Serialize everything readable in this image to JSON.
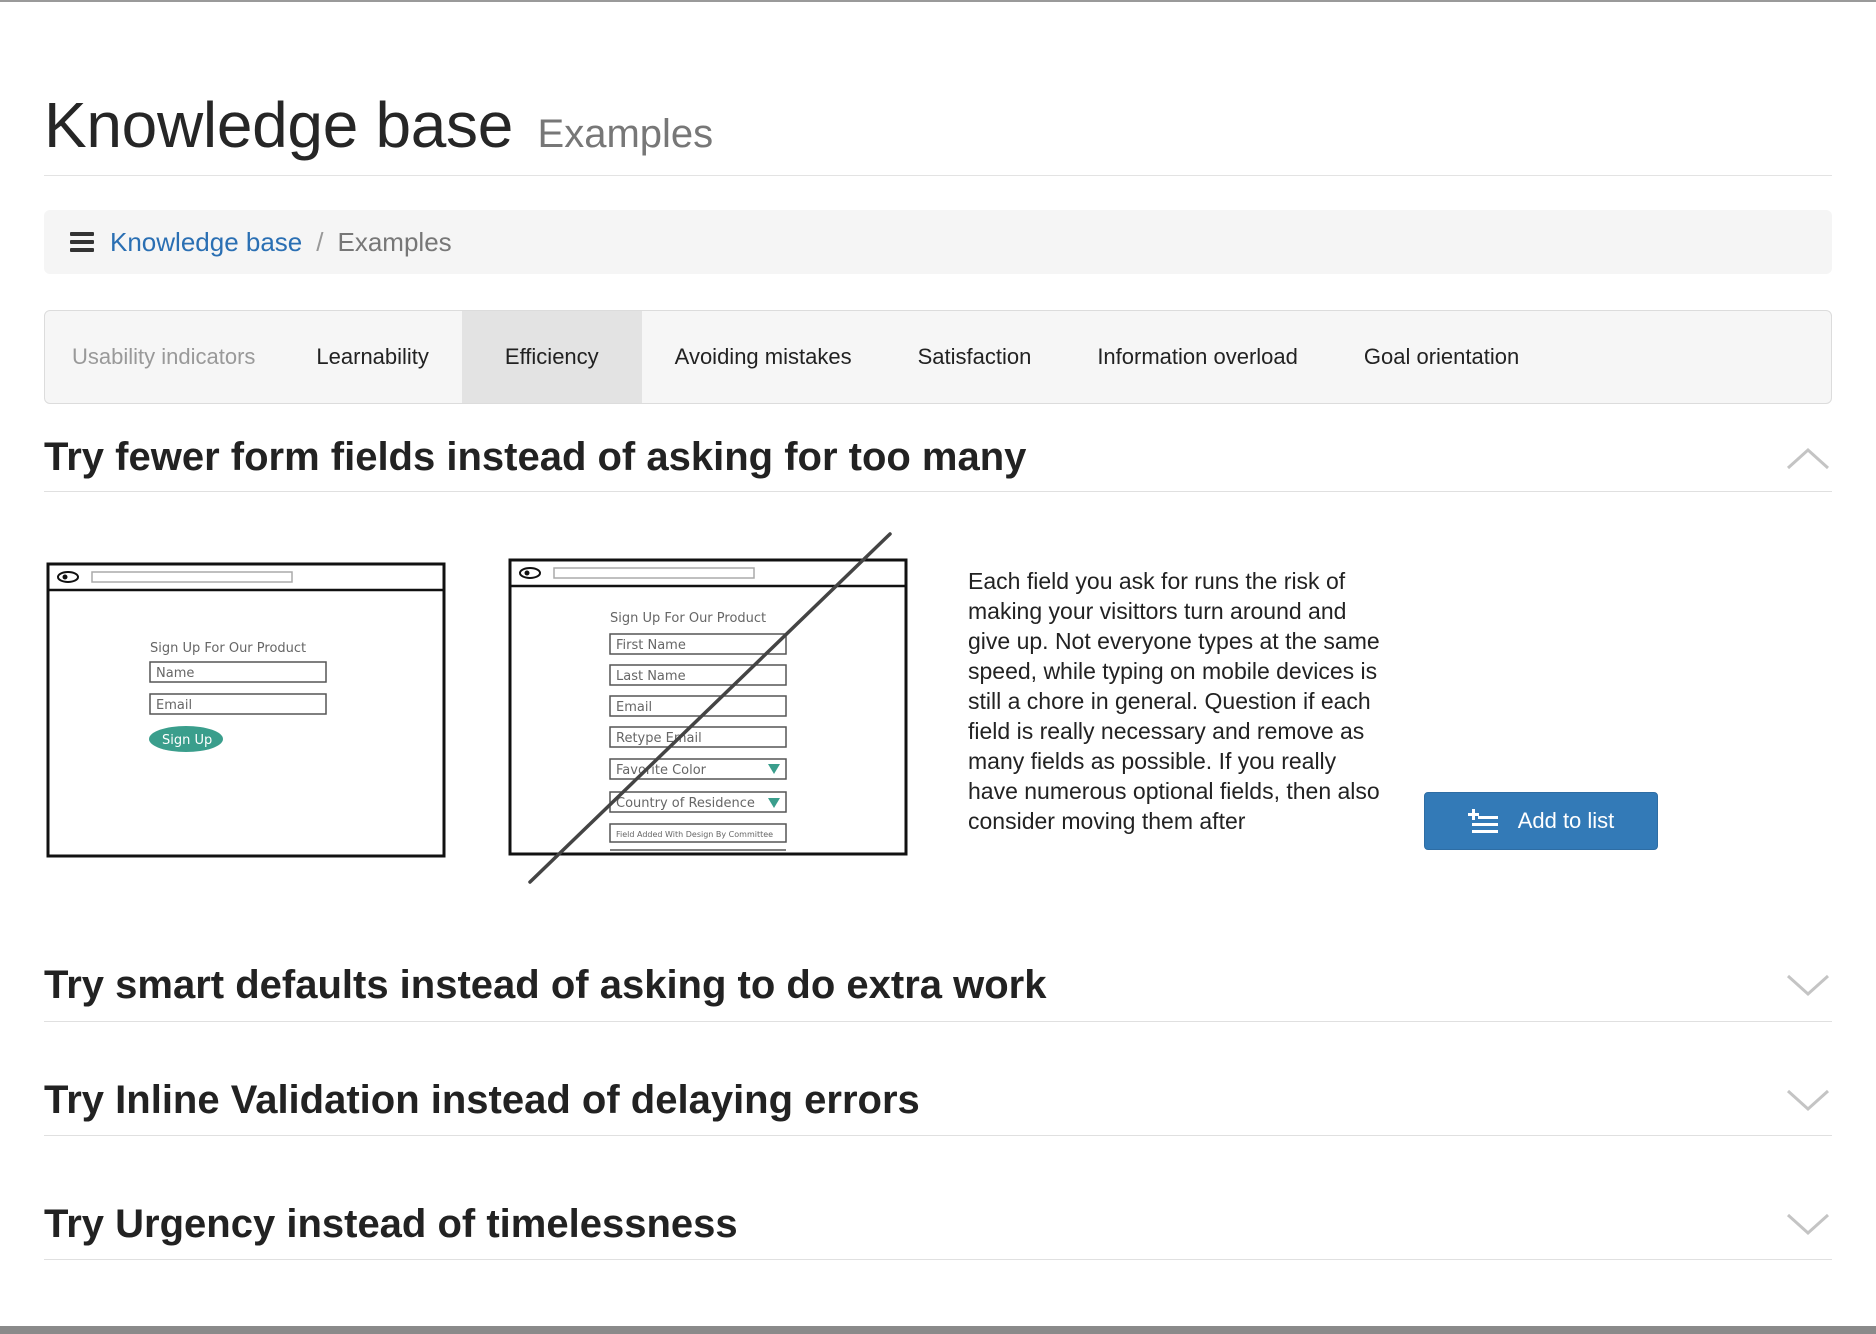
{
  "header": {
    "title": "Knowledge base",
    "subtitle": "Examples"
  },
  "breadcrumb": {
    "icon": "list-icon",
    "link_label": "Knowledge base",
    "separator": "/",
    "current": "Examples"
  },
  "tabs": {
    "label": "Usability indicators",
    "items": [
      {
        "label": "Learnability",
        "active": false
      },
      {
        "label": "Efficiency",
        "active": true
      },
      {
        "label": "Avoiding mistakes",
        "active": false
      },
      {
        "label": "Satisfaction",
        "active": false
      },
      {
        "label": "Information overload",
        "active": false
      },
      {
        "label": "Goal orientation",
        "active": false
      }
    ]
  },
  "sections": [
    {
      "title": "Try fewer form fields instead of asking for too many",
      "expanded": true
    },
    {
      "title": "Try smart defaults instead of asking to do extra work",
      "expanded": false
    },
    {
      "title": "Try Inline Validation instead of delaying errors",
      "expanded": false
    },
    {
      "title": "Try Urgency instead of timelessness",
      "expanded": false
    }
  ],
  "expanded_content": {
    "good_sketch": {
      "heading": "Sign Up For Our Product",
      "fields": [
        "Name",
        "Email"
      ],
      "button": "Sign Up"
    },
    "bad_sketch": {
      "heading": "Sign Up For Our Product",
      "fields": [
        "First Name",
        "Last Name",
        "Email",
        "Retype Email",
        "Favorite Color",
        "Country of Residence",
        "Field Added With Design By Committee"
      ]
    },
    "description": "Each field you ask for runs the risk of making your visittors turn around and give up. Not everyone types at the same speed, while typing on mobile devices is still a chore in general. Question if each field is really necessary and remove as many fields as possible. If you really have numerous optional fields, then also consider moving them after",
    "add_button_label": "Add to list",
    "accent_color": "#337ab7",
    "sketch_button_color": "#3a9e8c"
  }
}
